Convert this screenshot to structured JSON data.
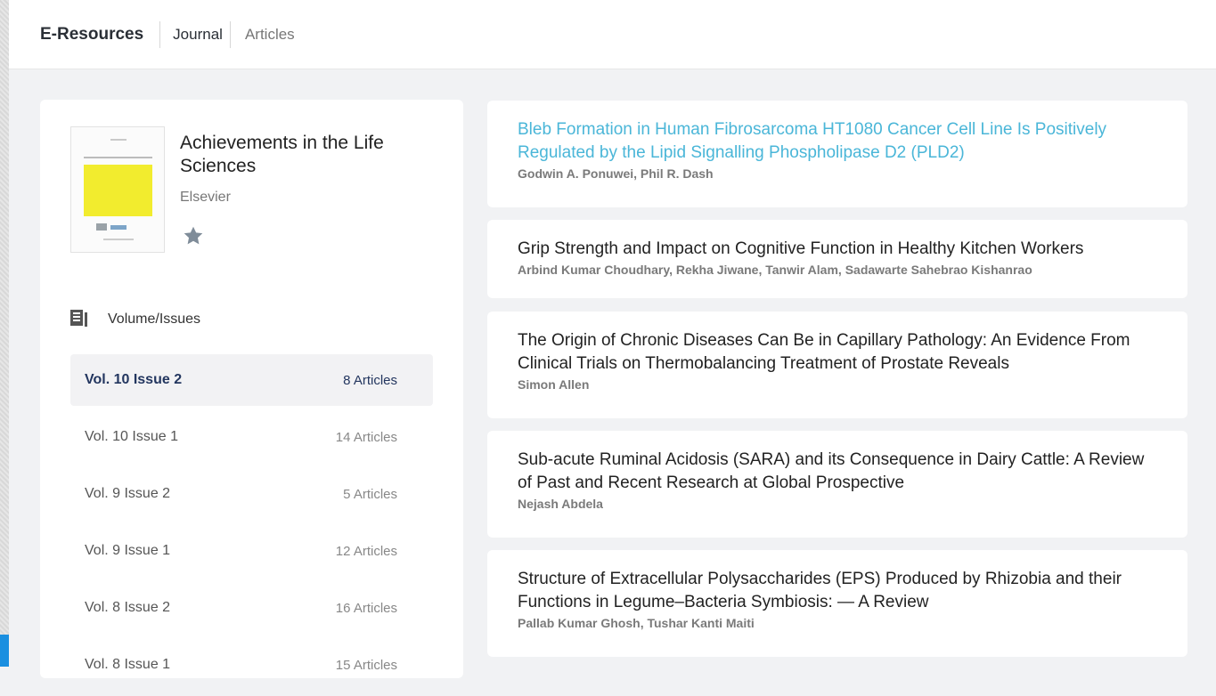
{
  "header": {
    "brand": "E-Resources",
    "nav": [
      "Journal",
      "Articles"
    ]
  },
  "journal": {
    "title": "Achievements in the Life Sciences",
    "publisher": "Elsevier",
    "favorite_icon": "star-icon"
  },
  "volumes": {
    "heading": "Volume/Issues",
    "icon": "document-list-icon",
    "items": [
      {
        "name": "Vol. 10 Issue 2",
        "count": "8 Articles",
        "selected": true
      },
      {
        "name": "Vol. 10 Issue 1",
        "count": "14 Articles"
      },
      {
        "name": "Vol. 9 Issue 2",
        "count": "5 Articles"
      },
      {
        "name": "Vol. 9 Issue 1",
        "count": "12 Articles"
      },
      {
        "name": "Vol. 8 Issue 2",
        "count": "16 Articles"
      },
      {
        "name": "Vol. 8 Issue 1",
        "count": "15 Articles"
      }
    ]
  },
  "articles": [
    {
      "title": "Bleb Formation in Human Fibrosarcoma HT1080 Cancer Cell Line Is Positively Regulated by the Lipid Signalling Phospholipase D2 (PLD2)",
      "authors": "Godwin A. Ponuwei, Phil R. Dash"
    },
    {
      "title": "Grip Strength and Impact on Cognitive Function in Healthy Kitchen Workers",
      "authors": "Arbind Kumar Choudhary, Rekha Jiwane, Tanwir Alam, Sadawarte Sahebrao Kishanrao"
    },
    {
      "title": "The Origin of Chronic Diseases Can Be in Capillary Pathology: An Evidence From Clinical Trials on Thermobalancing Treatment of Prostate Reveals",
      "authors": "Simon Allen"
    },
    {
      "title": "Sub-acute Ruminal Acidosis (SARA) and its Consequence in Dairy Cattle: A Review of Past and Recent Research at Global Prospective",
      "authors": "Nejash Abdela"
    },
    {
      "title": "Structure of Extracellular Polysaccharides (EPS) Produced by Rhizobia and their Functions in Legume–Bacteria Symbiosis: — A Review",
      "authors": "Pallab Kumar Ghosh, Tushar Kanti Maiti"
    }
  ],
  "colors": {
    "link": "#4ab6d8",
    "selected_text": "#23365f",
    "selected_bg": "#f2f2f4"
  }
}
